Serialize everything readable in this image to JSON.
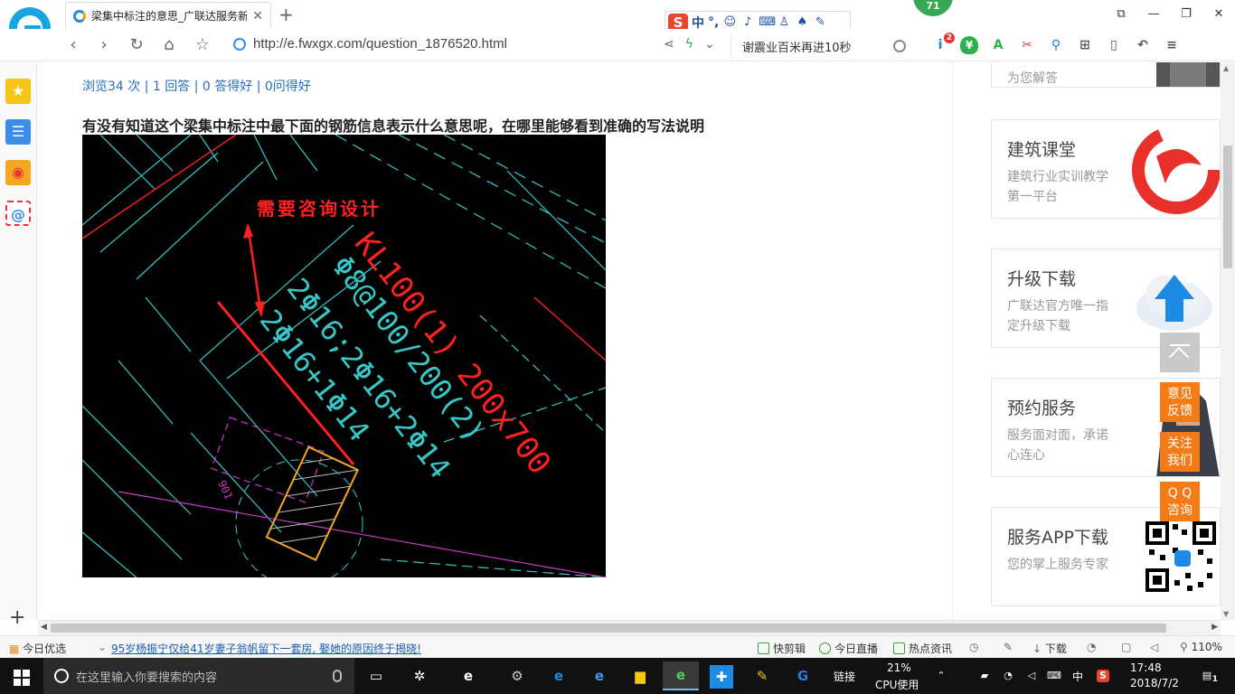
{
  "browser": {
    "tab_title": "梁集中标注的意思_广联达服务新",
    "new_tab": "+",
    "url": "http://e.fwxgx.com/question_1876520.html",
    "search_text": "谢震业百米再进10秒",
    "badge_count": "71",
    "ime_lang": "中",
    "ime_punct": "°,",
    "ext_badge": "2",
    "win": {
      "tile": "⧉",
      "min": "—",
      "max": "❐",
      "close": "✕"
    },
    "nav": {
      "back": "‹",
      "forward": "›",
      "refresh": "↻",
      "home": "⌂",
      "star": "☆"
    }
  },
  "page": {
    "stats": {
      "views": "浏览34 次",
      "answers": "1 回答",
      "good_answers": "0 答得好",
      "good_questions": "0问得好",
      "sep": "|"
    },
    "question": "有没有知道这个梁集中标注中最下面的钢筋信息表示什么意思呢，在哪里能够看到准确的写法说明",
    "image_annotation": "需要咨询设计",
    "cad_labels": {
      "beam": "KL100(1) 200x700",
      "stirrup": "Φ8@100/200(2)",
      "top": "2Φ16;2Φ16+2Φ14",
      "bottom": "2Φ16+1Φ14",
      "small": "901"
    }
  },
  "sidebar": {
    "top_card_desc": "为您解答",
    "cards": [
      {
        "title": "建筑课堂",
        "desc": "建筑行业实训教学第一平台"
      },
      {
        "title": "升级下载",
        "desc": "广联达官方唯一指定升级下载"
      },
      {
        "title": "预约服务",
        "desc": "服务面对面，承诺心连心"
      },
      {
        "title": "服务APP下载",
        "desc": "您的掌上服务专家"
      }
    ],
    "float": {
      "feedback": [
        "意见",
        "反馈"
      ],
      "follow": [
        "关注",
        "我们"
      ],
      "qq": [
        "Q Q",
        "咨询"
      ]
    }
  },
  "statusbar": {
    "today_pick": "今日优选",
    "news": "95岁杨振宁仅给41岁妻子翁帆留下一套房, 娶她的原因终于揭晓!",
    "clip": "快剪辑",
    "live": "今日直播",
    "hot": "热点资讯",
    "download": "下载",
    "zoom": "110%"
  },
  "taskbar": {
    "search_placeholder": "在这里输入你要搜索的内容",
    "links": "链接",
    "cpu_pct": "21%",
    "cpu_label": "CPU使用",
    "lang": "中",
    "time": "17:48",
    "date": "2018/7/2",
    "notif": "1"
  },
  "colors": {
    "accent_blue": "#2a6ebb",
    "orange": "#f57b17",
    "cad_red": "#ff2020",
    "cad_cyan": "#39c6c6"
  }
}
